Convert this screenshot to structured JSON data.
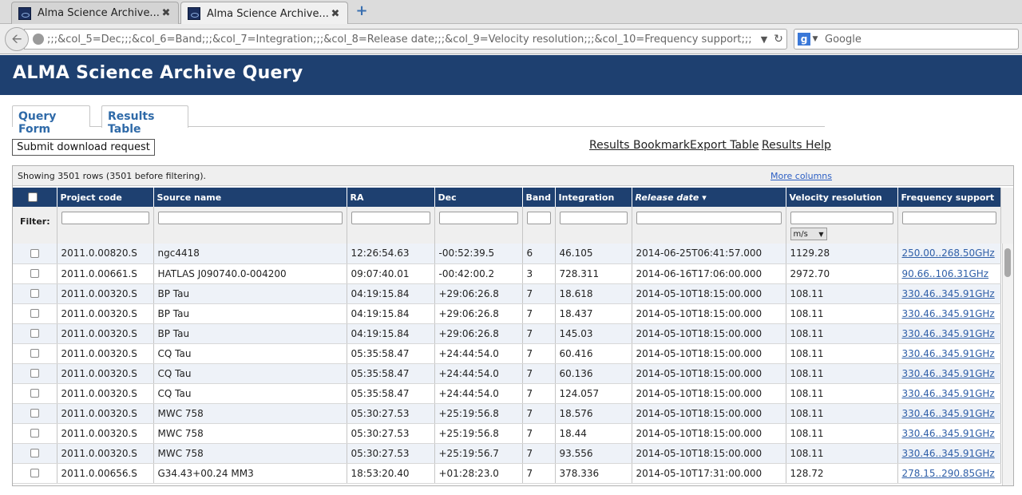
{
  "browser": {
    "tabs": [
      {
        "title": "Alma Science Archive...",
        "close": "✖"
      },
      {
        "title": "Alma Science Archive...",
        "close": "✖"
      }
    ],
    "new_tab": "+",
    "url": ";;;&col_5=Dec;;;&col_6=Band;;;&col_7=Integration;;;&col_8=Release date;;;&col_9=Velocity resolution;;;&col_10=Frequency support;;;",
    "search_placeholder": "Google"
  },
  "page": {
    "title": "ALMA Science Archive Query",
    "tabs": [
      "Query Form",
      "Results Table"
    ],
    "submit_label": "Submit download request",
    "links": [
      "Results Bookmark",
      "Export Table",
      "Results Help"
    ],
    "row_count_text": "Showing 3501 rows (3501 before filtering).",
    "more_columns": "More columns",
    "filter_label": "Filter:",
    "velocity_unit": "m/s"
  },
  "table": {
    "columns": [
      "Project code",
      "Source name",
      "RA",
      "Dec",
      "Band",
      "Integration",
      "Release date ▾",
      "Velocity resolution",
      "Frequency support"
    ],
    "rows": [
      [
        "2011.0.00820.S",
        "ngc4418",
        "12:26:54.63",
        "-00:52:39.5",
        "6",
        "46.105",
        "2014-06-25T06:41:57.000",
        "1129.28",
        "250.00..268.50GHz"
      ],
      [
        "2011.0.00661.S",
        "HATLAS J090740.0-004200",
        "09:07:40.01",
        "-00:42:00.2",
        "3",
        "728.311",
        "2014-06-16T17:06:00.000",
        "2972.70",
        "90.66..106.31GHz"
      ],
      [
        "2011.0.00320.S",
        "BP Tau",
        "04:19:15.84",
        "+29:06:26.8",
        "7",
        "18.618",
        "2014-05-10T18:15:00.000",
        "108.11",
        "330.46..345.91GHz"
      ],
      [
        "2011.0.00320.S",
        "BP Tau",
        "04:19:15.84",
        "+29:06:26.8",
        "7",
        "18.437",
        "2014-05-10T18:15:00.000",
        "108.11",
        "330.46..345.91GHz"
      ],
      [
        "2011.0.00320.S",
        "BP Tau",
        "04:19:15.84",
        "+29:06:26.8",
        "7",
        "145.03",
        "2014-05-10T18:15:00.000",
        "108.11",
        "330.46..345.91GHz"
      ],
      [
        "2011.0.00320.S",
        "CQ Tau",
        "05:35:58.47",
        "+24:44:54.0",
        "7",
        "60.416",
        "2014-05-10T18:15:00.000",
        "108.11",
        "330.46..345.91GHz"
      ],
      [
        "2011.0.00320.S",
        "CQ Tau",
        "05:35:58.47",
        "+24:44:54.0",
        "7",
        "60.136",
        "2014-05-10T18:15:00.000",
        "108.11",
        "330.46..345.91GHz"
      ],
      [
        "2011.0.00320.S",
        "CQ Tau",
        "05:35:58.47",
        "+24:44:54.0",
        "7",
        "124.057",
        "2014-05-10T18:15:00.000",
        "108.11",
        "330.46..345.91GHz"
      ],
      [
        "2011.0.00320.S",
        "MWC 758",
        "05:30:27.53",
        "+25:19:56.8",
        "7",
        "18.576",
        "2014-05-10T18:15:00.000",
        "108.11",
        "330.46..345.91GHz"
      ],
      [
        "2011.0.00320.S",
        "MWC 758",
        "05:30:27.53",
        "+25:19:56.8",
        "7",
        "18.44",
        "2014-05-10T18:15:00.000",
        "108.11",
        "330.46..345.91GHz"
      ],
      [
        "2011.0.00320.S",
        "MWC 758",
        "05:30:27.53",
        "+25:19:56.7",
        "7",
        "93.556",
        "2014-05-10T18:15:00.000",
        "108.11",
        "330.46..345.91GHz"
      ],
      [
        "2011.0.00656.S",
        "G34.43+00.24 MM3",
        "18:53:20.40",
        "+01:28:23.0",
        "7",
        "378.336",
        "2014-05-10T17:31:00.000",
        "128.72",
        "278.15..290.85GHz"
      ]
    ]
  },
  "colors": {
    "header_bg": "#1e4070",
    "link": "#2f5fa8",
    "row_alt": "#eef2f8"
  }
}
